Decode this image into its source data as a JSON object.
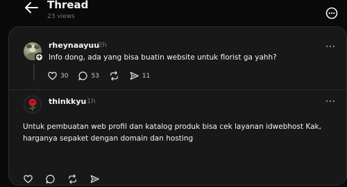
{
  "header": {
    "title": "Thread",
    "views": "23 views"
  },
  "posts": [
    {
      "username": "rheynaayuu",
      "time": "2h",
      "text": "Info dong, ada yang bisa buatin website untuk florist ga yahh?",
      "counts": {
        "likes": "30",
        "replies": "53",
        "shares": "11"
      }
    },
    {
      "username": "thinkkyu",
      "time": "1h",
      "text": "Untuk pembuatan web profil dan katalog produk bisa cek layanan idwebhost Kak, harganya sepaket dengan domain dan hosting"
    }
  ],
  "icons": [
    "back-arrow-icon",
    "more-circle-icon",
    "heart-icon",
    "comment-icon",
    "repost-icon",
    "share-icon",
    "more-dots-icon",
    "rose-icon"
  ]
}
